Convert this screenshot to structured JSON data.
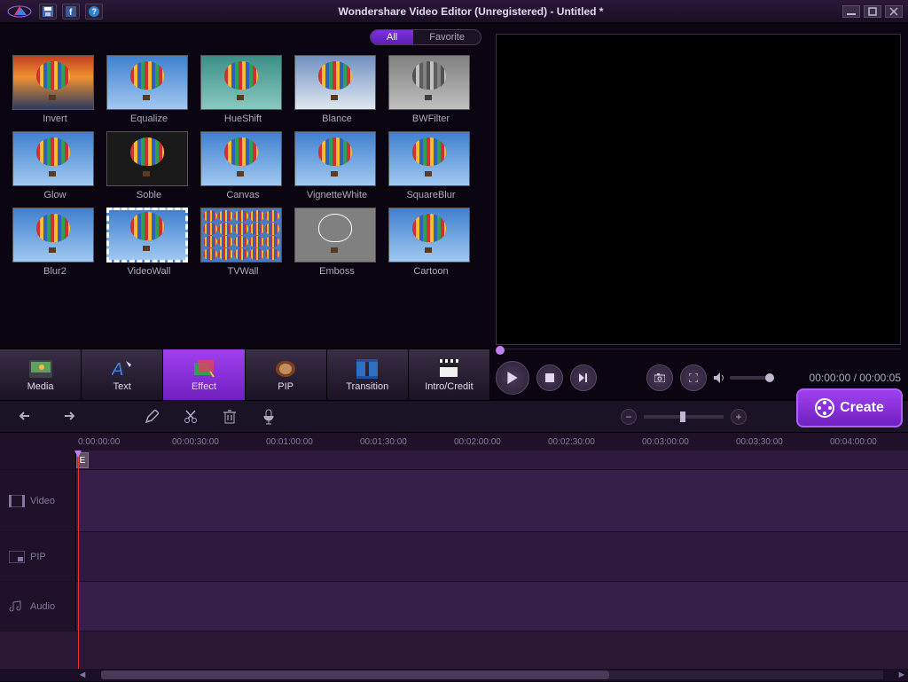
{
  "app": {
    "title": "Wondershare Video Editor (Unregistered) - Untitled *"
  },
  "filter_tabs": {
    "all": "All",
    "favorite": "Favorite",
    "active": "all"
  },
  "effects": [
    {
      "name": "Invert",
      "style": "sky-orange"
    },
    {
      "name": "Equalize",
      "style": "sky-blue"
    },
    {
      "name": "HueShift",
      "style": "sky-teal"
    },
    {
      "name": "Blance",
      "style": "sky-white"
    },
    {
      "name": "BWFilter",
      "style": "sky-gray"
    },
    {
      "name": "Glow",
      "style": "sky-blue"
    },
    {
      "name": "Soble",
      "style": "sky-dark"
    },
    {
      "name": "Canvas",
      "style": "sky-blue"
    },
    {
      "name": "VignetteWhite",
      "style": "sky-blue"
    },
    {
      "name": "SquareBlur",
      "style": "sky-blue"
    },
    {
      "name": "Blur2",
      "style": "sky-blue"
    },
    {
      "name": "VideoWall",
      "style": "sky-blue stamp"
    },
    {
      "name": "TVWall",
      "style": "wall"
    },
    {
      "name": "Emboss",
      "style": "emboss-bg"
    },
    {
      "name": "Cartoon",
      "style": "sky-blue"
    }
  ],
  "categories": [
    {
      "key": "media",
      "label": "Media"
    },
    {
      "key": "text",
      "label": "Text"
    },
    {
      "key": "effect",
      "label": "Effect",
      "active": true
    },
    {
      "key": "pip",
      "label": "PIP"
    },
    {
      "key": "transition",
      "label": "Transition"
    },
    {
      "key": "intro",
      "label": "Intro/Credit"
    }
  ],
  "preview": {
    "time_current": "00:00:00",
    "time_total": "00:00:05"
  },
  "create": {
    "label": "Create"
  },
  "timeline": {
    "marks": [
      "0:00:00:00",
      "00:00:30:00",
      "00:01:00:00",
      "00:01:30:00",
      "00:02:00:00",
      "00:02:30:00",
      "00:03:00:00",
      "00:03:30:00",
      "00:04:00:00"
    ],
    "tracks": {
      "video": "Video",
      "pip": "PIP",
      "audio": "Audio"
    },
    "clip_label": "E"
  }
}
